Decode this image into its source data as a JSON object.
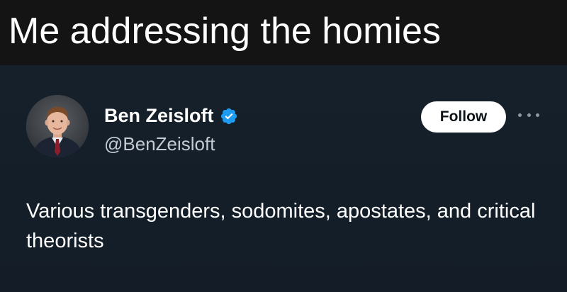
{
  "caption": {
    "text": "Me addressing the homies"
  },
  "tweet": {
    "author": {
      "display_name": "Ben Zeisloft",
      "handle": "@BenZeisloft",
      "verified": true,
      "verified_icon": "verified-badge-icon",
      "avatar": "profile-photo"
    },
    "follow_label": "Follow",
    "more_icon": "more-options-icon",
    "text": "Various transgenders, sodomites, apostates, and critical theorists"
  },
  "colors": {
    "background": "#15202b",
    "caption_background": "#141414",
    "verified_blue": "#1d9bf0",
    "text_primary": "#ffffff",
    "text_secondary": "#c4cbd3"
  }
}
